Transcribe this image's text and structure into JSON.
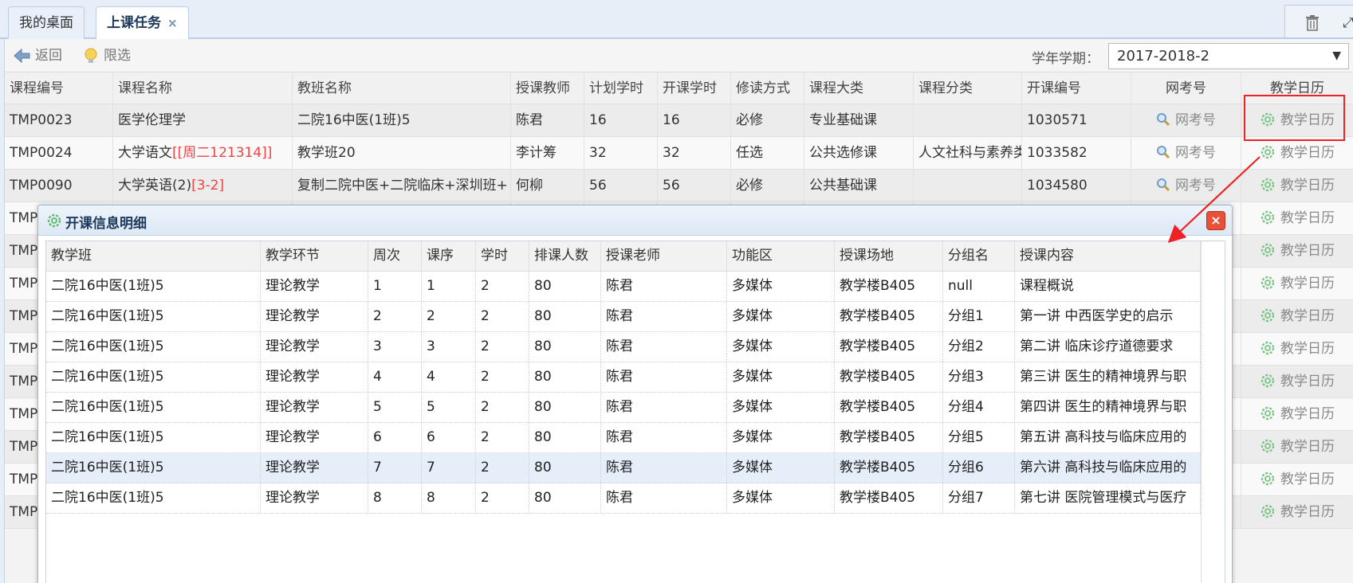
{
  "tabs": [
    {
      "label": "我的桌面"
    },
    {
      "label": "上课任务",
      "close": "×"
    }
  ],
  "toolbar": {
    "back_label": "返回",
    "limit_label": "限选",
    "term_label": "学年学期：",
    "term_value": "2017-2018-2",
    "term_arrow": "▼"
  },
  "main_grid": {
    "headers": [
      "课程编号",
      "课程名称",
      "教班名称",
      "授课教师",
      "计划学时",
      "开课学时",
      "修读方式",
      "课程大类",
      "课程分类",
      "开课编号",
      "网考号",
      "教学日历"
    ],
    "rows": [
      {
        "code": "TMP0023",
        "name": "医学伦理学",
        "name_extra": "",
        "class": "二院16中医(1班)5",
        "teacher": "陈君",
        "plan": "16",
        "open": "16",
        "mode": "必修",
        "major": "专业基础课",
        "minor": "",
        "open_no": "1030571",
        "exam": "网考号",
        "cal": "教学日历"
      },
      {
        "code": "TMP0024",
        "name": "大学语文",
        "name_extra": "[[周二121314]]",
        "class": "教学班20",
        "teacher": "李计筹",
        "plan": "32",
        "open": "32",
        "mode": "任选",
        "major": "公共选修课",
        "minor": "人文社科与素养类",
        "open_no": "1033582",
        "exam": "网考号",
        "cal": "教学日历"
      },
      {
        "code": "TMP0090",
        "name": "大学英语(2)",
        "name_extra": "[3-2]",
        "class": "复制二院中医+二院临床+深圳班+",
        "teacher": "何柳",
        "plan": "56",
        "open": "56",
        "mode": "必修",
        "major": "公共基础课",
        "minor": "",
        "open_no": "1034580",
        "exam": "网考号",
        "cal": "教学日历"
      }
    ],
    "hidden_row_prefix": "TMP",
    "hidden_rows_count_label": "",
    "extra_cal_label": "教学日历"
  },
  "dialog": {
    "title": "开课信息明细",
    "close": "×",
    "headers": [
      "教学班",
      "教学环节",
      "周次",
      "课序",
      "学时",
      "排课人数",
      "授课老师",
      "功能区",
      "授课场地",
      "分组名",
      "授课内容"
    ],
    "rows": [
      [
        "二院16中医(1班)5",
        "理论教学",
        "1",
        "1",
        "2",
        "80",
        "陈君",
        "多媒体",
        "教学楼B405",
        "null",
        "课程概说"
      ],
      [
        "二院16中医(1班)5",
        "理论教学",
        "2",
        "2",
        "2",
        "80",
        "陈君",
        "多媒体",
        "教学楼B405",
        "分组1",
        "第一讲 中西医学史的启示"
      ],
      [
        "二院16中医(1班)5",
        "理论教学",
        "3",
        "3",
        "2",
        "80",
        "陈君",
        "多媒体",
        "教学楼B405",
        "分组2",
        "第二讲 临床诊疗道德要求"
      ],
      [
        "二院16中医(1班)5",
        "理论教学",
        "4",
        "4",
        "2",
        "80",
        "陈君",
        "多媒体",
        "教学楼B405",
        "分组3",
        "第三讲 医生的精神境界与职"
      ],
      [
        "二院16中医(1班)5",
        "理论教学",
        "5",
        "5",
        "2",
        "80",
        "陈君",
        "多媒体",
        "教学楼B405",
        "分组4",
        "第四讲 医生的精神境界与职"
      ],
      [
        "二院16中医(1班)5",
        "理论教学",
        "6",
        "6",
        "2",
        "80",
        "陈君",
        "多媒体",
        "教学楼B405",
        "分组5",
        "第五讲 高科技与临床应用的"
      ],
      [
        "二院16中医(1班)5",
        "理论教学",
        "7",
        "7",
        "2",
        "80",
        "陈君",
        "多媒体",
        "教学楼B405",
        "分组6",
        "第六讲 高科技与临床应用的"
      ],
      [
        "二院16中医(1班)5",
        "理论教学",
        "8",
        "8",
        "2",
        "80",
        "陈君",
        "多媒体",
        "教学楼B405",
        "分组7",
        "第七讲 医院管理模式与医疗"
      ]
    ],
    "selected_row": 6
  },
  "colors": {
    "highlight": "#ee2222",
    "accent": "#1d3a5c",
    "icon_green": "#5fb96a",
    "red_text": "#ee4444"
  }
}
